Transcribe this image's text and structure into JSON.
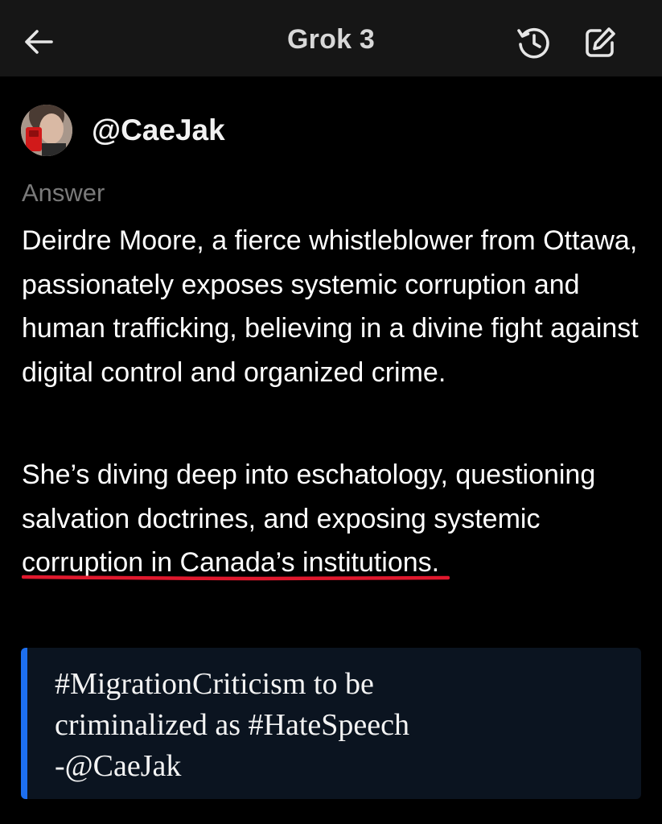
{
  "header": {
    "title": "Grok 3",
    "back_icon": "arrow-left-icon",
    "history_icon": "history-icon",
    "compose_icon": "edit-icon"
  },
  "user": {
    "handle": "@CaeJak"
  },
  "answer": {
    "label": "Answer",
    "paragraph1": "Deirdre Moore, a fierce whistleblower from Ottawa, passionately exposes systemic corruption and human trafficking, believing in a divine fight against digital control and organized crime.",
    "paragraph2_before": "She’s diving deep into eschatology, questioning salvation doctrines, and ",
    "paragraph2_highlight": "exposing systemic corruption",
    "paragraph2_after": " in Canada’s institutions."
  },
  "quote": {
    "line1": "#MigrationCriticism to be",
    "line2": "criminalized as #HateSpeech",
    "line3": "-@CaeJak"
  },
  "colors": {
    "background": "#000000",
    "header_bg": "#161616",
    "quote_bg": "#0b1420",
    "quote_accent": "#1d6ff0",
    "underline": "#e0182d"
  }
}
